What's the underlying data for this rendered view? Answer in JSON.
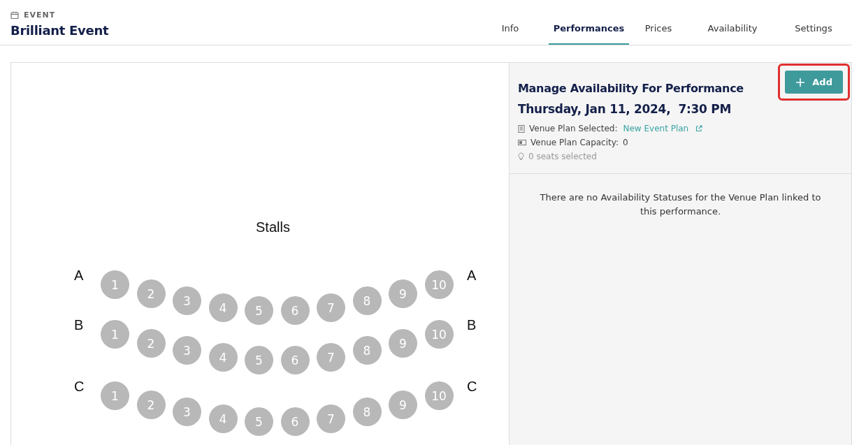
{
  "header": {
    "eyebrow": "EVENT",
    "title": "Brilliant Event"
  },
  "tabs": [
    {
      "label": "Info",
      "selected": false
    },
    {
      "label": "Performances",
      "selected": true
    },
    {
      "label": "Prices",
      "selected": false
    },
    {
      "label": "Availability",
      "selected": false
    },
    {
      "label": "Settings",
      "selected": false
    }
  ],
  "seat_map": {
    "section": "Stalls",
    "rows": [
      {
        "label_left": "A",
        "label_right": "A",
        "seats": [
          "1",
          "2",
          "3",
          "4",
          "5",
          "6",
          "7",
          "8",
          "9",
          "10"
        ]
      },
      {
        "label_left": "B",
        "label_right": "B",
        "seats": [
          "1",
          "2",
          "3",
          "4",
          "5",
          "6",
          "7",
          "8",
          "9",
          "10"
        ]
      },
      {
        "label_left": "C",
        "label_right": "C",
        "seats": [
          "1",
          "2",
          "3",
          "4",
          "5",
          "6",
          "7",
          "8",
          "9",
          "10"
        ]
      }
    ]
  },
  "panel": {
    "title": "Manage Availability For Performance",
    "add_button": {
      "label": "Add",
      "highlighted": true
    },
    "date": "Thursday, Jan 11, 2024,  7:30 PM",
    "details": [
      {
        "kind": "plan",
        "label": "Venue Plan Selected:",
        "link": "New Event Plan"
      },
      {
        "kind": "capacity",
        "label": "Venue Plan Capacity:",
        "value": "0"
      },
      {
        "kind": "selection",
        "label": "0 seats selected"
      }
    ],
    "empty_message": "There are no Availability Statuses for the Venue Plan linked to this performance."
  }
}
